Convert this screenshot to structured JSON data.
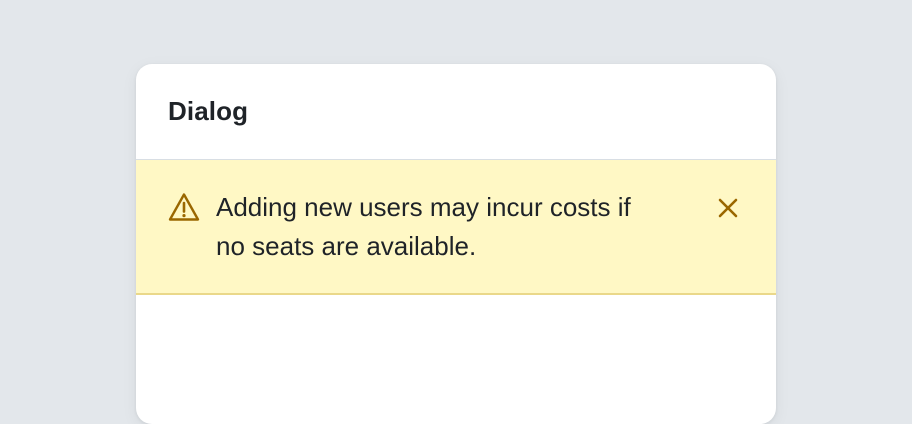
{
  "dialog": {
    "title": "Dialog"
  },
  "flash": {
    "variant": "warning",
    "message": "Adding new users may incur costs if no seats are available.",
    "icon": "alert-triangle-icon",
    "dismiss_icon": "close-icon",
    "colors": {
      "background": "#fff8c5",
      "border": "#ead88a",
      "icon": "#9a6700"
    }
  },
  "page": {
    "background": "#e3e7eb"
  }
}
